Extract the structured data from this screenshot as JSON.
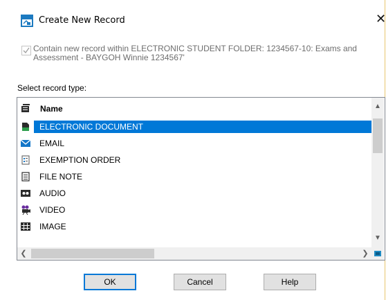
{
  "window": {
    "title": "Create New Record",
    "close_glyph": "✕"
  },
  "contain": {
    "checked": true,
    "text": "Contain new record within ELECTRONIC STUDENT FOLDER: 1234567-10: Exams and Assessment - BAYGOH Winnie 1234567'"
  },
  "select_label": "Select record type:",
  "list": {
    "header": "Name",
    "items": [
      {
        "label": "ELECTRONIC DOCUMENT",
        "icon": "document-icon",
        "selected": true
      },
      {
        "label": "EMAIL",
        "icon": "envelope-icon",
        "selected": false
      },
      {
        "label": "EXEMPTION ORDER",
        "icon": "form-icon",
        "selected": false
      },
      {
        "label": "FILE NOTE",
        "icon": "note-icon",
        "selected": false
      },
      {
        "label": "AUDIO",
        "icon": "cassette-icon",
        "selected": false
      },
      {
        "label": "VIDEO",
        "icon": "film-camera-icon",
        "selected": false
      },
      {
        "label": "IMAGE",
        "icon": "image-grid-icon",
        "selected": false
      }
    ]
  },
  "buttons": {
    "ok": "OK",
    "cancel": "Cancel",
    "help": "Help"
  },
  "colors": {
    "selection": "#0078d7",
    "window_border": "#e8c770"
  }
}
